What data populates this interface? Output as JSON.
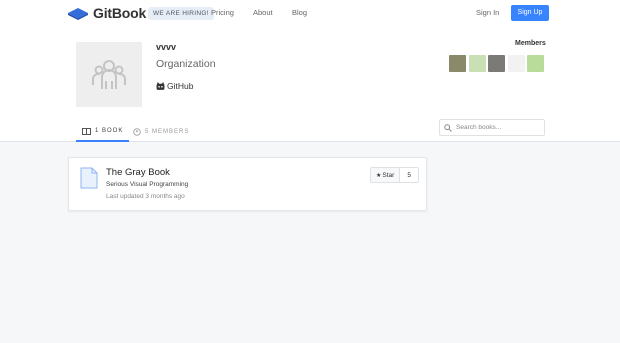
{
  "nav": {
    "logo_text": "GitBook",
    "hiring_badge": "WE ARE HIRING!",
    "links": [
      "Pricing",
      "About",
      "Blog"
    ],
    "sign_in": "Sign In",
    "sign_up": "Sign Up",
    "accent_color": "#3884ff"
  },
  "org": {
    "name": "vvvv",
    "type": "Organization",
    "github_label": "GitHub"
  },
  "members": {
    "title": "Members",
    "avatars": [
      {
        "name": "member-avatar-1",
        "color": "#8a8a6a"
      },
      {
        "name": "member-avatar-2",
        "color": "#c8e0b4"
      },
      {
        "name": "member-avatar-3",
        "color": "#7c7a76"
      },
      {
        "name": "member-avatar-4",
        "color": "#f2f2f2"
      },
      {
        "name": "member-avatar-5",
        "color": "#b9dc9a"
      }
    ]
  },
  "tabs": {
    "books": "1 BOOK",
    "members": "5 MEMBERS"
  },
  "search": {
    "placeholder": "Search books..."
  },
  "book": {
    "title": "The Gray Book",
    "description": "Serious Visual Programming",
    "updated": "Last updated 3 months ago",
    "star_label": "Star",
    "star_count": "5"
  }
}
